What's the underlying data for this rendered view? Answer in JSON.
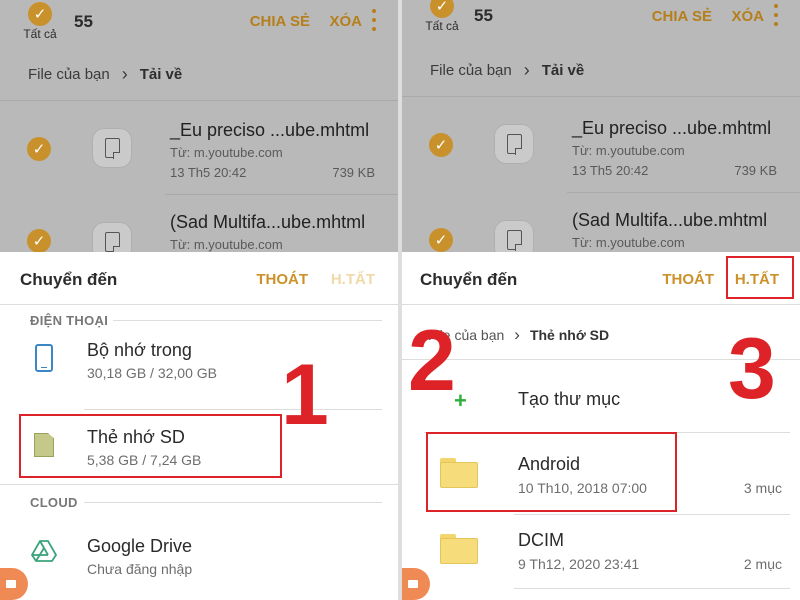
{
  "colors": {
    "accent": "#c9912c",
    "annotation_red": "#dd2327",
    "dim_overlay": "#b9b9b9"
  },
  "appbar": {
    "select_all_label": "Tất cả",
    "count": "55",
    "share_label": "CHIA SẺ",
    "delete_label": "XÓA"
  },
  "breadcrumb": {
    "root": "File của bạn",
    "current": "Tải về"
  },
  "files": [
    {
      "name": "_Eu preciso ...ube.mhtml",
      "source": "Từ: m.youtube.com",
      "date": "13 Th5 20:42",
      "size": "739 KB"
    },
    {
      "name": "(Sad Multifa...ube.mhtml",
      "source": "Từ: m.youtube.com"
    }
  ],
  "sheet": {
    "title": "Chuyển đến",
    "cancel_label": "THOÁT",
    "done_label": "H.TẤT"
  },
  "left_sheet": {
    "section_phone": "ĐIỆN THOẠI",
    "section_cloud": "CLOUD",
    "locations": [
      {
        "name": "Bộ nhớ trong",
        "detail": "30,18 GB / 32,00 GB",
        "icon": "phone-icon"
      },
      {
        "name": "Thẻ nhớ SD",
        "detail": "5,38 GB / 7,24 GB",
        "icon": "sd-card-icon"
      },
      {
        "name": "Google Drive",
        "detail": "Chưa đăng nhập",
        "icon": "google-drive-icon"
      }
    ]
  },
  "right_sheet": {
    "breadcrumb": {
      "root": "File của bạn",
      "current": "Thẻ nhớ SD"
    },
    "new_folder_label": "Tạo thư mục",
    "folders": [
      {
        "name": "Android",
        "date": "10 Th10, 2018 07:00",
        "count": "3 mục"
      },
      {
        "name": "DCIM",
        "date": "9 Th12, 2020 23:41",
        "count": "2 mục"
      }
    ]
  },
  "annotations": {
    "step1": "1",
    "step2": "2",
    "step3": "3"
  }
}
